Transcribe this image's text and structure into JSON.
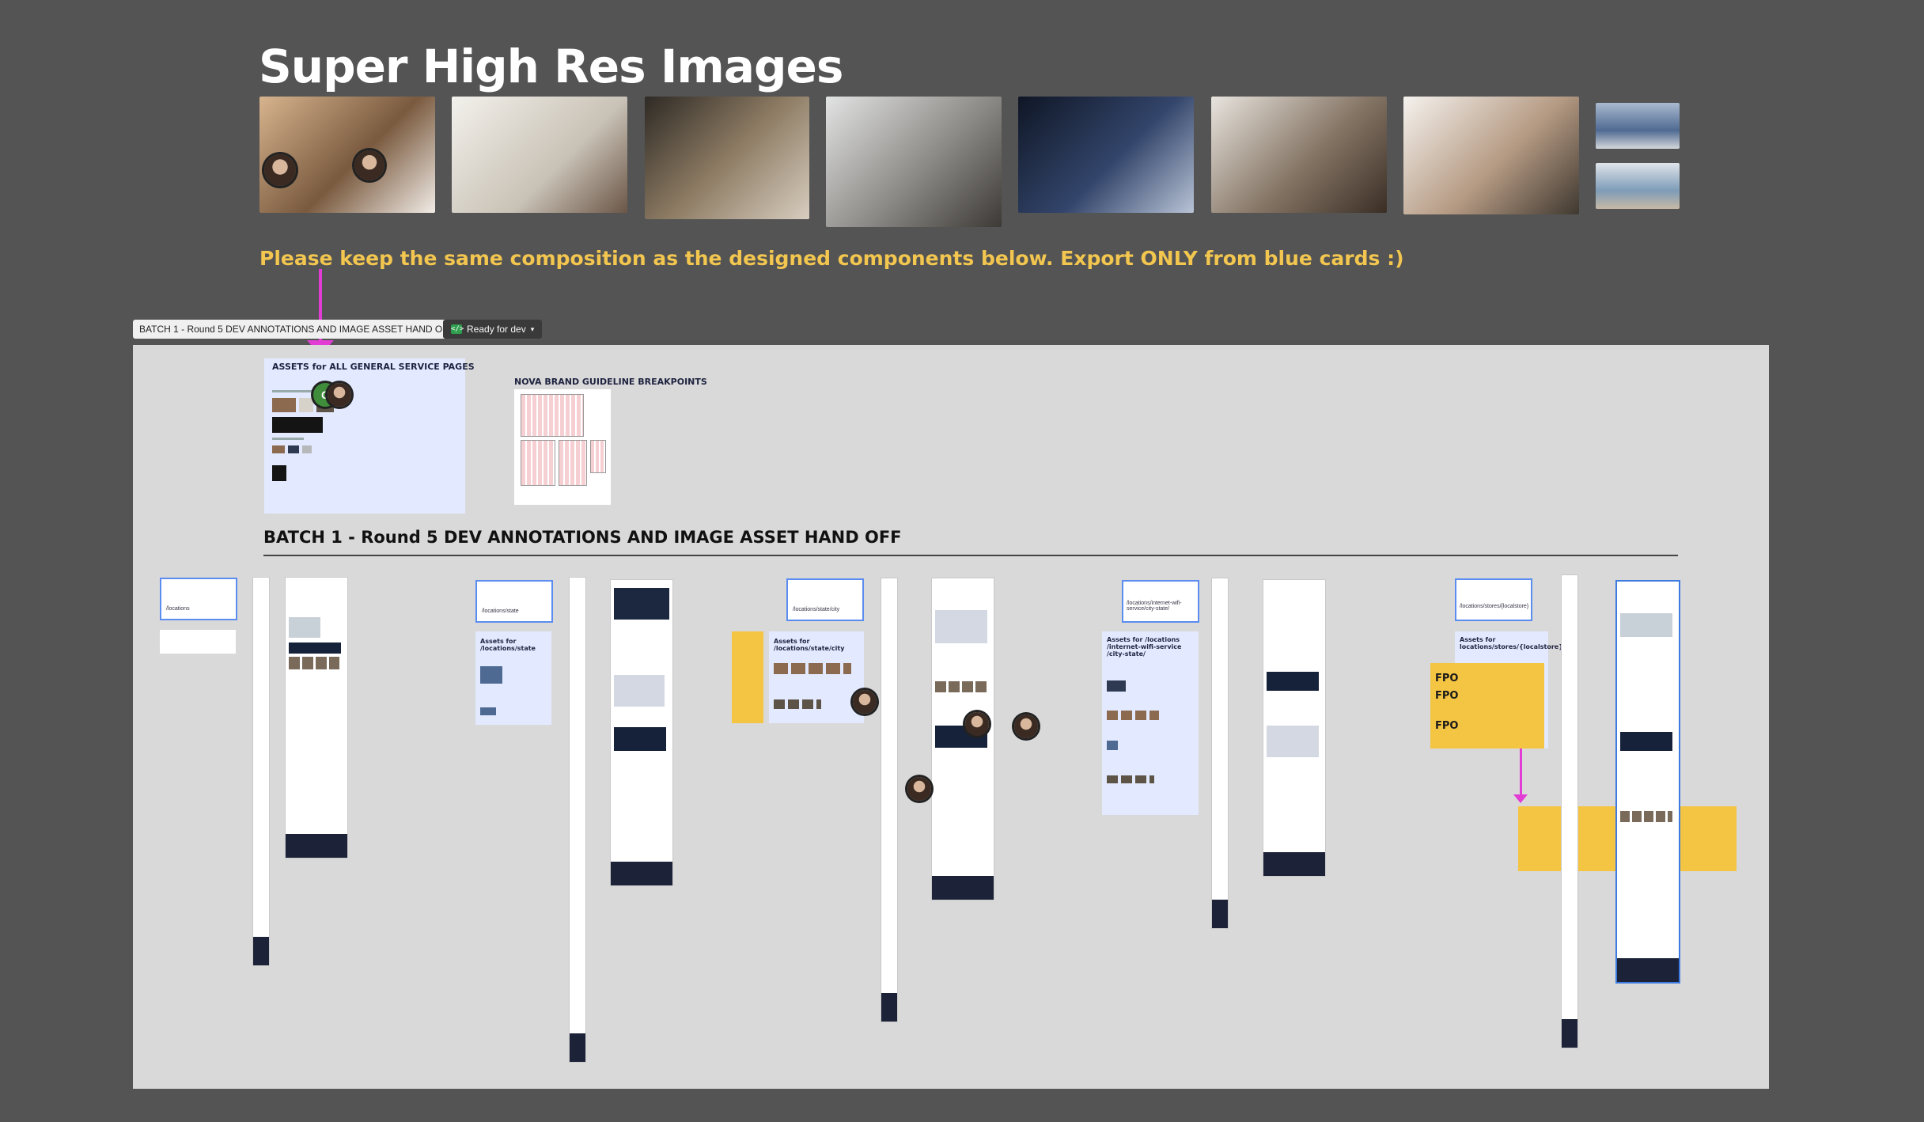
{
  "header": {
    "title": "Super High Res Images",
    "notice": "Please keep the same composition as the designed components below. Export ONLY from blue cards :)"
  },
  "frame": {
    "name": "BATCH 1 - Round 5 DEV ANNOTATIONS AND IMAGE ASSET HAND OFF",
    "status": "Ready for dev",
    "status_icon": "code-icon"
  },
  "photos": [
    {
      "name": "couple-laptop-photo",
      "color": "#8c6a4e"
    },
    {
      "name": "woman-kitchen-photo",
      "color": "#d8d3ca"
    },
    {
      "name": "family-cooking-photo",
      "color": "#5d5346"
    },
    {
      "name": "man-phone-photo",
      "color": "#b6b8ba"
    },
    {
      "name": "technician-photo",
      "color": "#2e3a52"
    },
    {
      "name": "family-couch-photo",
      "color": "#9a8f82"
    },
    {
      "name": "couple-coffee-photo",
      "color": "#b9aea3"
    },
    {
      "name": "storefront-photo",
      "color": "#7f8ea8"
    },
    {
      "name": "store-interior-photo",
      "color": "#9ab0c0"
    }
  ],
  "canvas": {
    "general_card_title": "ASSETS for ALL GENERAL SERVICE PAGES",
    "brand_guideline_title": "NOVA BRAND GUIDELINE BREAKPOINTS",
    "batch_title": "BATCH 1 - Round 5 DEV ANNOTATIONS AND IMAGE ASSET HAND OFF",
    "avatar_initial": "C",
    "sections": [
      {
        "route": "/locations"
      },
      {
        "route": "/locations/state",
        "assets_label": "Assets for /locations/state"
      },
      {
        "route": "/locations/state/city",
        "assets_label": "Assets for /locations/state/city"
      },
      {
        "route": "/locations/internet-wifi-service/city-state/",
        "assets_label": "Assets for /locations /internet-wifi-service /city-state/"
      },
      {
        "route": "/locations/stores/{localstore}",
        "assets_label": "Assets for locations/stores/{localstore}"
      }
    ],
    "fpo_label": "FPO"
  }
}
